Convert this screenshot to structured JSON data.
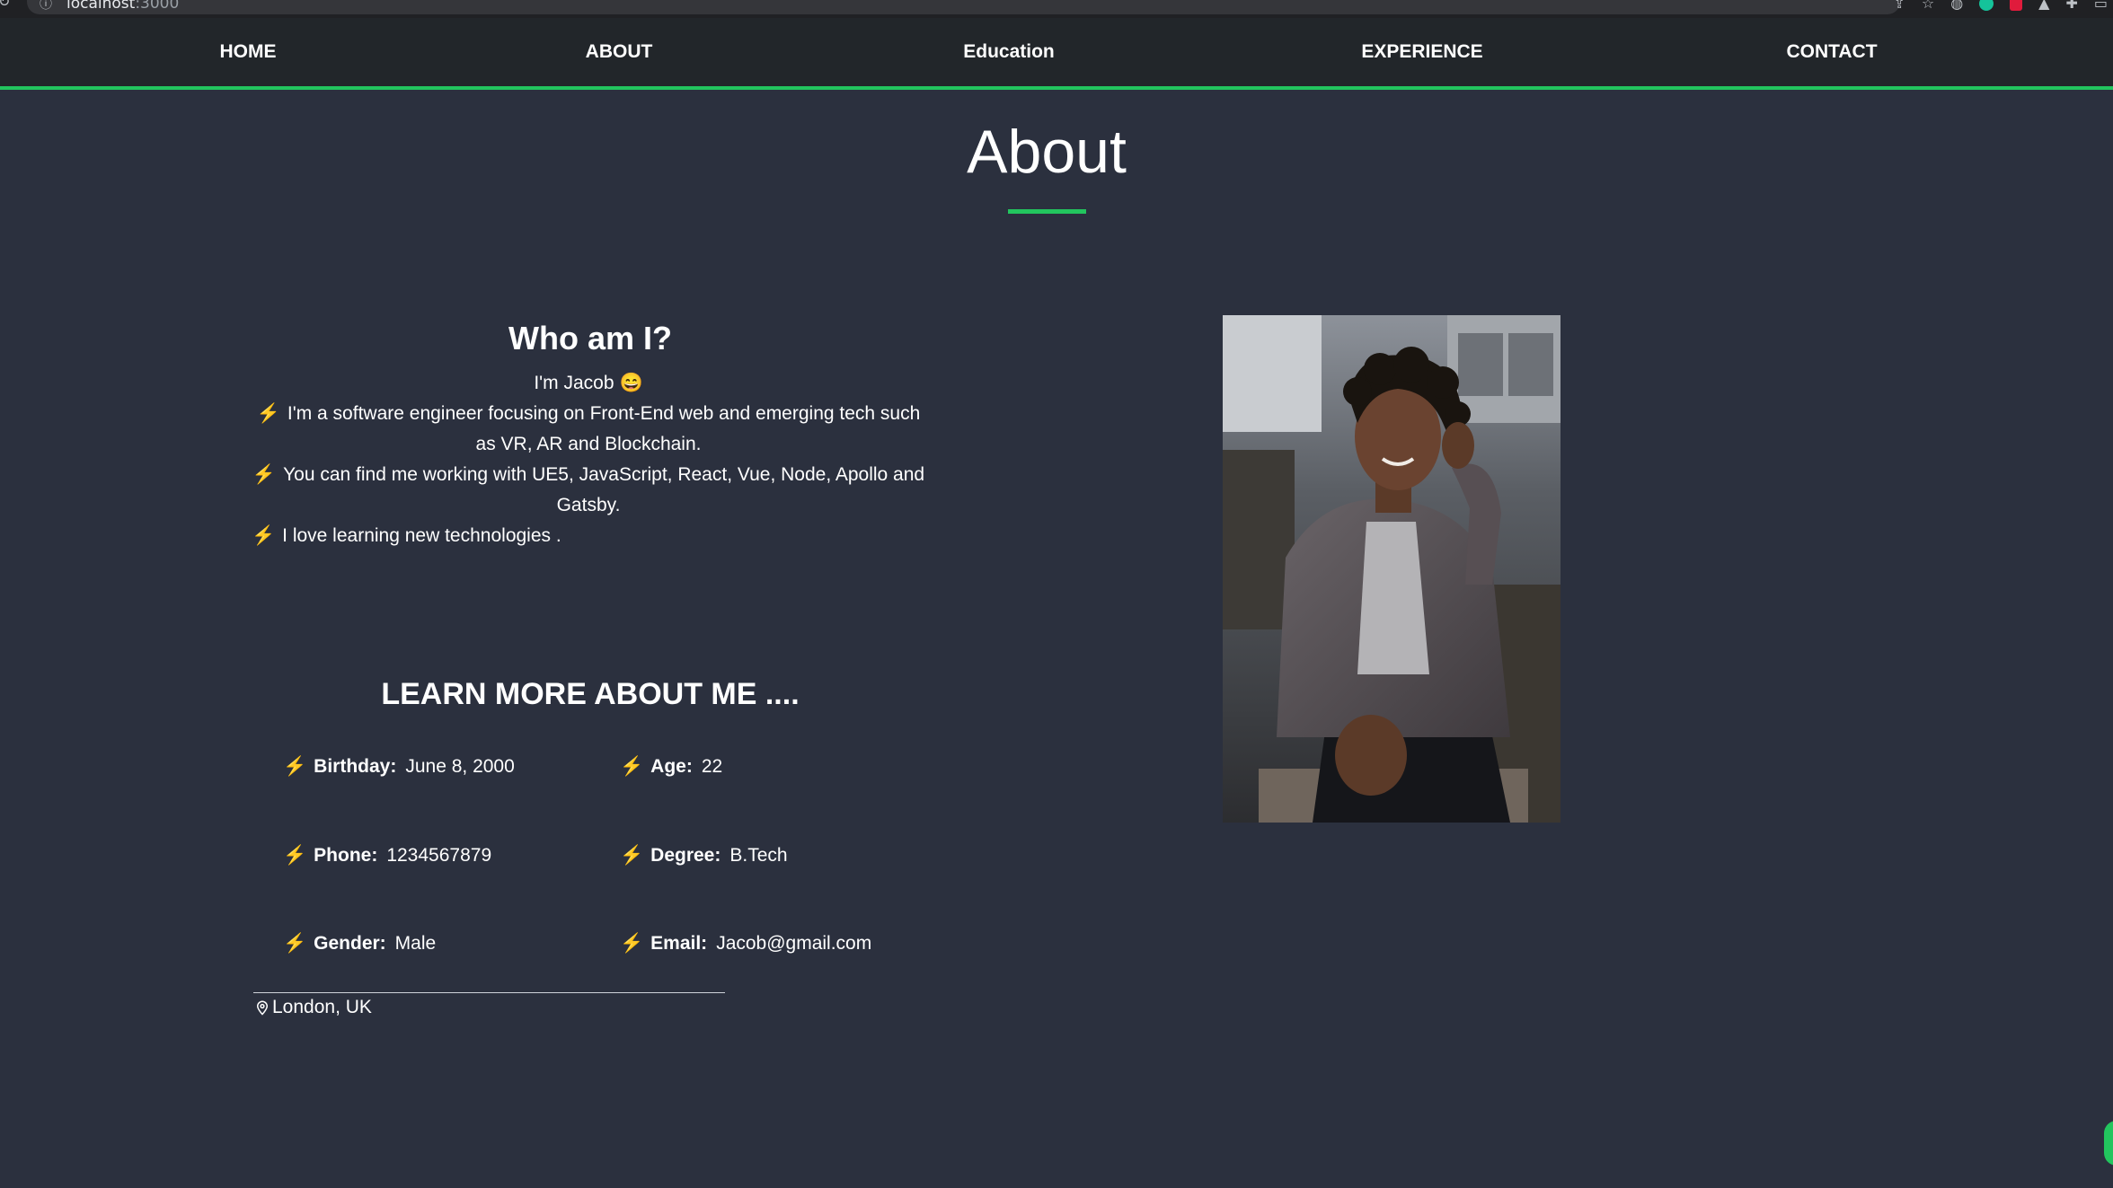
{
  "browser": {
    "url_host": "localhost",
    "url_port": ":3000"
  },
  "nav": {
    "items": [
      {
        "label": "HOME"
      },
      {
        "label": "ABOUT"
      },
      {
        "label": "Education"
      },
      {
        "label": "EXPERIENCE"
      },
      {
        "label": "CONTACT"
      }
    ]
  },
  "about": {
    "title": "About",
    "who_heading": "Who am I?",
    "greeting": "I'm Jacob",
    "greeting_emoji": "😄",
    "lines": [
      "I'm a software engineer focusing on Front-End web and emerging tech such as VR, AR and Blockchain.",
      "You can find me working with UE5, JavaScript, React, Vue, Node, Apollo and Gatsby.",
      "I love learning new technologies ."
    ],
    "bolt_glyph": "⚡",
    "learn_heading": "LEARN MORE ABOUT ME ....",
    "details": {
      "birthday": {
        "label": "Birthday:",
        "value": "June 8, 2000"
      },
      "age": {
        "label": "Age:",
        "value": "22"
      },
      "phone": {
        "label": "Phone:",
        "value": "1234567879"
      },
      "degree": {
        "label": "Degree:",
        "value": "B.Tech"
      },
      "gender": {
        "label": "Gender:",
        "value": "Male"
      },
      "email": {
        "label": "Email:",
        "value": "Jacob@gmail.com"
      }
    },
    "location": "London, UK"
  },
  "colors": {
    "background": "#2b303e",
    "nav_background": "#22262a",
    "accent": "#22c55e",
    "bolt": "#f6c23e"
  },
  "icons": {
    "bolt": "lightning-bolt-icon",
    "pin": "map-pin-icon"
  }
}
